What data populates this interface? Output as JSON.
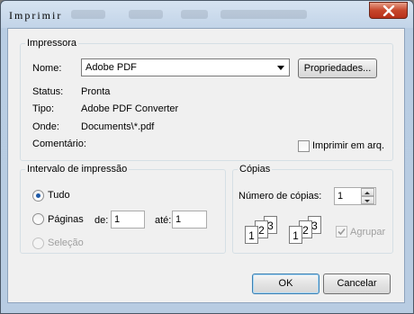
{
  "window": {
    "title": "Imprimir",
    "close_symbol": "✕"
  },
  "printer": {
    "legend": "Impressora",
    "name_label": "Nome:",
    "selected_printer": "Adobe PDF",
    "properties_button": "Propriedades...",
    "status_label": "Status:",
    "status_value": "Pronta",
    "type_label": "Tipo:",
    "type_value": "Adobe PDF Converter",
    "where_label": "Onde:",
    "where_value": "Documents\\*.pdf",
    "comment_label": "Comentário:",
    "print_to_file_label": "Imprimir em arq.",
    "print_to_file_checked": false
  },
  "range": {
    "legend": "Intervalo de impressão",
    "all_label": "Tudo",
    "pages_label": "Páginas",
    "from_label": "de:",
    "from_value": "1",
    "to_label": "até:",
    "to_value": "1",
    "selection_label": "Seleção",
    "selected": "all"
  },
  "copies": {
    "legend": "Cópias",
    "count_label": "Número de cópias:",
    "count_value": "1",
    "collate_label": "Agrupar",
    "collate_checked": true,
    "collate_illustration_pages": [
      "1",
      "2",
      "3"
    ]
  },
  "actions": {
    "ok_label": "OK",
    "cancel_label": "Cancelar"
  }
}
